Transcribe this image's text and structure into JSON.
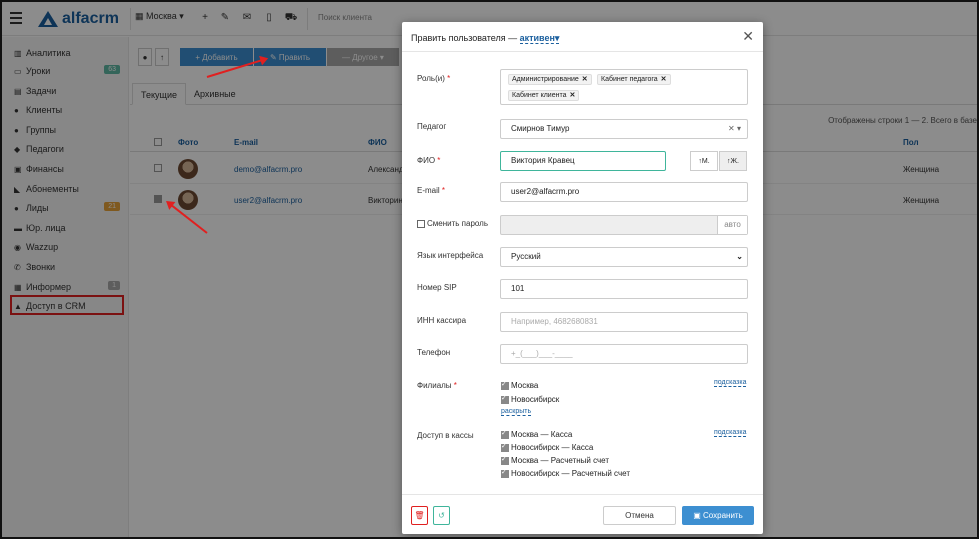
{
  "header": {
    "logo": "alfacrm",
    "city": "Москва",
    "search_placeholder": "Поиск клиента"
  },
  "sidebar": {
    "items": [
      {
        "icon": "chart-icon",
        "label": "Аналитика"
      },
      {
        "icon": "calendar-icon",
        "label": "Уроки",
        "badge": "63"
      },
      {
        "icon": "tasks-icon",
        "label": "Задачи"
      },
      {
        "icon": "user-icon",
        "label": "Клиенты"
      },
      {
        "icon": "users-icon",
        "label": "Группы"
      },
      {
        "icon": "graduation-icon",
        "label": "Педагоги"
      },
      {
        "icon": "money-icon",
        "label": "Финансы"
      },
      {
        "icon": "tag-icon",
        "label": "Абонементы"
      },
      {
        "icon": "lead-icon",
        "label": "Лиды",
        "badge": "21"
      },
      {
        "icon": "briefcase-icon",
        "label": "Юр. лица"
      },
      {
        "icon": "whatsapp-icon",
        "label": "Wazzup"
      },
      {
        "icon": "phone-icon",
        "label": "Звонки"
      },
      {
        "icon": "inbox-icon",
        "label": "Информер",
        "badge": "1"
      },
      {
        "icon": "lock-icon",
        "label": "Доступ в CRM"
      }
    ]
  },
  "toolbar": {
    "add_label": "+ Добавить",
    "edit_label": "✎ Править",
    "other_label": "— Другое ▾"
  },
  "tabs": [
    "Текущие",
    "Архивные"
  ],
  "table": {
    "rows_info": "Отображены строки 1 — 2. Всего в базе",
    "columns": [
      "Фото",
      "E-mail",
      "ФИО",
      "Пол"
    ],
    "rows": [
      {
        "email": "demo@alfacrm.pro",
        "fio": "Александ",
        "gender": "Женщина",
        "checked": false
      },
      {
        "email": "user2@alfacrm.pro",
        "fio": "Викторин",
        "gender": "Женщина",
        "checked": true
      }
    ]
  },
  "modal": {
    "title": "Править пользователя —",
    "status": "активен",
    "roles_label": "Роль(и)",
    "roles": [
      "Администрирование",
      "Кабинет педагога",
      "Кабинет клиента"
    ],
    "teacher_label": "Педагог",
    "teacher_value": "Смирнов Тимур",
    "fio_label": "ФИО",
    "fio_value": "Виктория Кравец",
    "gender_m": "М.",
    "gender_f": "Ж.",
    "email_label": "E-mail",
    "email_value": "user2@alfacrm.pro",
    "change_pass_label": "Сменить пароль",
    "auto_label": "авто",
    "lang_label": "Язык интерфейса",
    "lang_value": "Русский",
    "sip_label": "Номер SIP",
    "sip_value": "101",
    "inn_label": "ИНН кассира",
    "inn_placeholder": "Например, 4682680831",
    "phone_label": "Телефон",
    "phone_placeholder": "+_(___)___-____",
    "branches_label": "Филиалы",
    "branches": [
      "Москва",
      "Новосибирск"
    ],
    "expand_label": "раскрыть",
    "hint_label": "подсказка",
    "cash_label": "Доступ в кассы",
    "cash": [
      "Москва — Касса",
      "Новосибирск — Касса",
      "Москва — Расчетный счет",
      "Новосибирск — Расчетный счет"
    ],
    "cancel_label": "Отмена",
    "save_label": "Сохранить"
  },
  "colors": {
    "accent": "#1a5f9e",
    "save": "#3d8fd1",
    "danger": "#e02020",
    "success": "#3fb59b"
  }
}
